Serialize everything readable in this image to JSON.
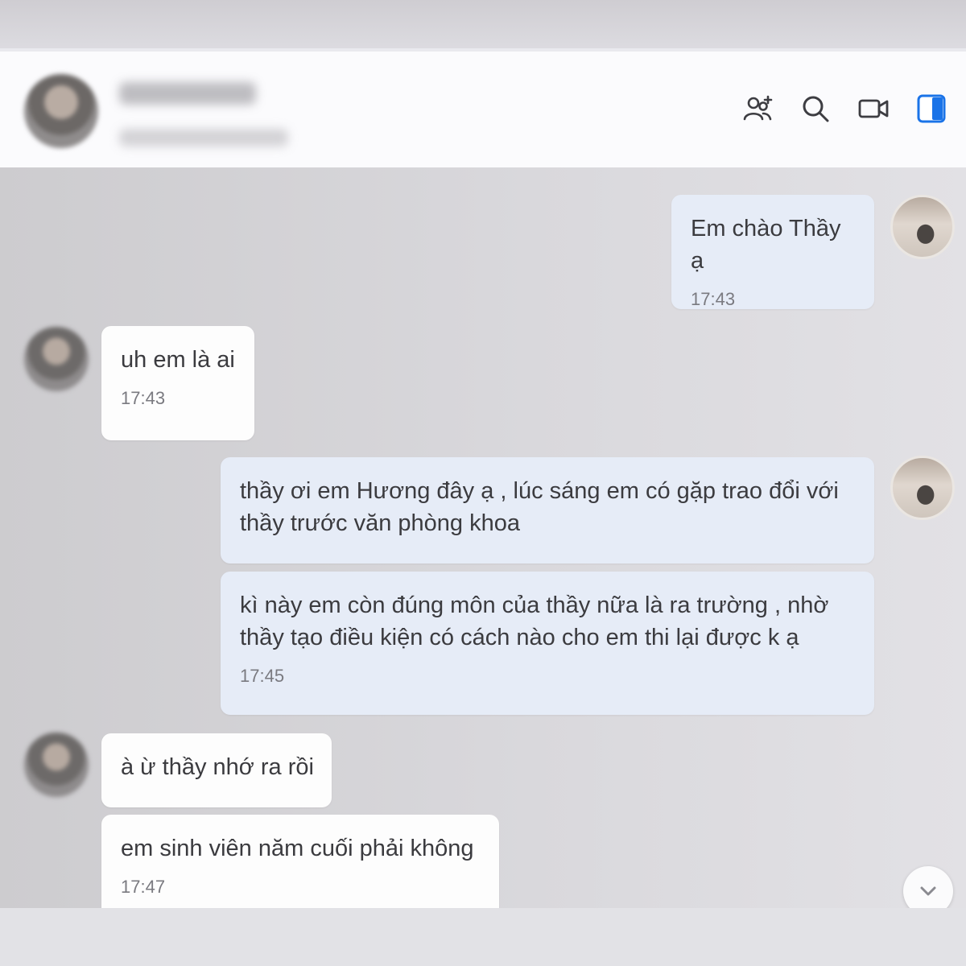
{
  "header": {
    "icons": [
      "add-member-icon",
      "search-icon",
      "video-call-icon",
      "sidebar-toggle-icon"
    ]
  },
  "messages": [
    {
      "direction": "out",
      "text": "Em chào Thầy ạ",
      "time": "17:43"
    },
    {
      "direction": "in",
      "text": "uh em là ai",
      "time": "17:43"
    },
    {
      "direction": "out",
      "text_lines": [
        "thầy ơi em Hương đây ạ , lúc sáng em có gặp trao đổi với",
        "thầy trước văn phòng khoa"
      ]
    },
    {
      "direction": "out",
      "text_lines": [
        "kì  này em còn đúng môn của thầy nữa là ra trường , nhờ",
        "thầy tạo điều kiện có cách nào cho em thi lại được k ạ"
      ],
      "time": "17:45"
    },
    {
      "direction": "in",
      "text": "à ừ thầy nhớ ra rồi"
    },
    {
      "direction": "in",
      "text": "em sinh viên năm cuối phải không",
      "time": "17:47"
    }
  ],
  "colors": {
    "outgoing_bubble": "#e6ecf7",
    "incoming_bubble": "#fdfdfd",
    "accent": "#1a73e8"
  }
}
